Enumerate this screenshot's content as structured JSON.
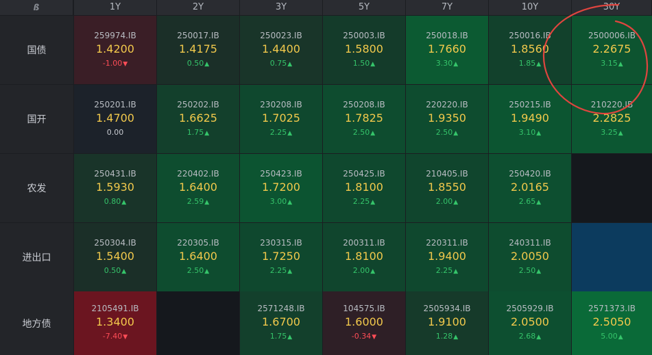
{
  "corner_glyph": "ß",
  "tenors": [
    "1Y",
    "2Y",
    "3Y",
    "5Y",
    "7Y",
    "10Y",
    "30Y"
  ],
  "colors": {
    "up": "#35c46a",
    "down": "#ff4d57",
    "flat": "#c9ccd2",
    "yield": "#f2c94c",
    "annotation": "#e0453f"
  },
  "rows": [
    {
      "label": "国债",
      "cells": [
        {
          "code": "259974.IB",
          "yield": "1.4200",
          "change": "-1.00",
          "dir": "down",
          "bg": "#3a1e26"
        },
        {
          "code": "250017.IB",
          "yield": "1.4175",
          "change": "0.50",
          "dir": "up",
          "bg": "#1b2f28"
        },
        {
          "code": "250023.IB",
          "yield": "1.4400",
          "change": "0.75",
          "dir": "up",
          "bg": "#193529"
        },
        {
          "code": "250003.IB",
          "yield": "1.5800",
          "change": "1.50",
          "dir": "up",
          "bg": "#143b2a"
        },
        {
          "code": "250018.IB",
          "yield": "1.7660",
          "change": "3.30",
          "dir": "up",
          "bg": "#0c5a32"
        },
        {
          "code": "250016.IB",
          "yield": "1.8560",
          "change": "1.85",
          "dir": "up",
          "bg": "#12412c"
        },
        {
          "code": "2500006.IB",
          "yield": "2.2675",
          "change": "3.15",
          "dir": "up",
          "bg": "#0d5430"
        }
      ]
    },
    {
      "label": "国开",
      "cells": [
        {
          "code": "250201.IB",
          "yield": "1.4700",
          "change": "0.00",
          "dir": "flat",
          "bg": "#1c222a"
        },
        {
          "code": "250202.IB",
          "yield": "1.6625",
          "change": "1.75",
          "dir": "up",
          "bg": "#13402c"
        },
        {
          "code": "230208.IB",
          "yield": "1.7025",
          "change": "2.25",
          "dir": "up",
          "bg": "#0f482e"
        },
        {
          "code": "250208.IB",
          "yield": "1.7825",
          "change": "2.50",
          "dir": "up",
          "bg": "#0e4c2f"
        },
        {
          "code": "220220.IB",
          "yield": "1.9350",
          "change": "2.50",
          "dir": "up",
          "bg": "#0e4c2f"
        },
        {
          "code": "250215.IB",
          "yield": "1.9490",
          "change": "3.10",
          "dir": "up",
          "bg": "#0c5531"
        },
        {
          "code": "210220.IB",
          "yield": "2.2825",
          "change": "3.25",
          "dir": "up",
          "bg": "#0c5732"
        }
      ]
    },
    {
      "label": "农发",
      "cells": [
        {
          "code": "250431.IB",
          "yield": "1.5930",
          "change": "0.80",
          "dir": "up",
          "bg": "#193429"
        },
        {
          "code": "220402.IB",
          "yield": "1.6400",
          "change": "2.59",
          "dir": "up",
          "bg": "#0e4d2f"
        },
        {
          "code": "250423.IB",
          "yield": "1.7200",
          "change": "3.00",
          "dir": "up",
          "bg": "#0c5431"
        },
        {
          "code": "250425.IB",
          "yield": "1.8100",
          "change": "2.25",
          "dir": "up",
          "bg": "#0f482e"
        },
        {
          "code": "210405.IB",
          "yield": "1.8550",
          "change": "2.00",
          "dir": "up",
          "bg": "#10452d"
        },
        {
          "code": "250420.IB",
          "yield": "2.0165",
          "change": "2.65",
          "dir": "up",
          "bg": "#0d4f30"
        },
        {
          "code": "",
          "yield": "",
          "change": "",
          "dir": "",
          "bg": "#15181d"
        }
      ]
    },
    {
      "label": "进出口",
      "cells": [
        {
          "code": "250304.IB",
          "yield": "1.5400",
          "change": "0.50",
          "dir": "up",
          "bg": "#1b2f28"
        },
        {
          "code": "220305.IB",
          "yield": "1.6400",
          "change": "2.50",
          "dir": "up",
          "bg": "#0e4c2f"
        },
        {
          "code": "230315.IB",
          "yield": "1.7250",
          "change": "2.25",
          "dir": "up",
          "bg": "#0f482e"
        },
        {
          "code": "200311.IB",
          "yield": "1.8100",
          "change": "2.00",
          "dir": "up",
          "bg": "#10452d"
        },
        {
          "code": "220311.IB",
          "yield": "1.9400",
          "change": "2.25",
          "dir": "up",
          "bg": "#0f482e"
        },
        {
          "code": "240311.IB",
          "yield": "2.0050",
          "change": "2.50",
          "dir": "up",
          "bg": "#0e4c2f"
        },
        {
          "code": "",
          "yield": "",
          "change": "",
          "dir": "",
          "bg": "#0c3b5e"
        }
      ]
    },
    {
      "label": "地方债",
      "cells": [
        {
          "code": "2105491.IB",
          "yield": "1.3400",
          "change": "-7.40",
          "dir": "down",
          "bg": "#6b1520"
        },
        {
          "code": "",
          "yield": "",
          "change": "",
          "dir": "",
          "bg": "#15181d"
        },
        {
          "code": "2571248.IB",
          "yield": "1.6700",
          "change": "1.75",
          "dir": "up",
          "bg": "#13402c"
        },
        {
          "code": "104575.IB",
          "yield": "1.6000",
          "change": "-0.34",
          "dir": "down",
          "bg": "#2e1f26"
        },
        {
          "code": "2505934.IB",
          "yield": "1.9100",
          "change": "1.28",
          "dir": "up",
          "bg": "#163a2a"
        },
        {
          "code": "2505929.IB",
          "yield": "2.0500",
          "change": "2.68",
          "dir": "up",
          "bg": "#0d4f30"
        },
        {
          "code": "2571373.IB",
          "yield": "2.5050",
          "change": "5.00",
          "dir": "up",
          "bg": "#0a6a38"
        }
      ]
    }
  ]
}
